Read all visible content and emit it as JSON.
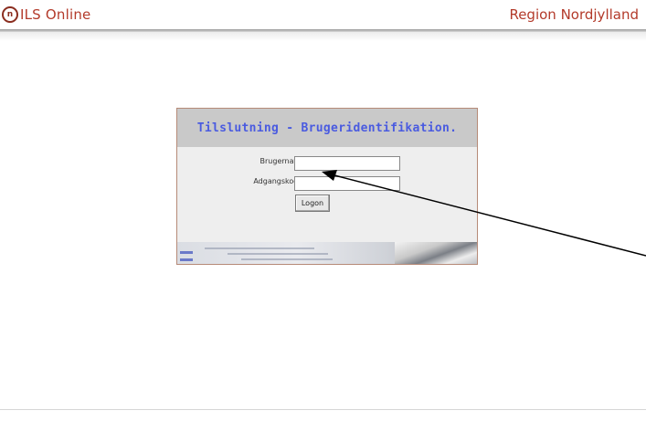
{
  "header": {
    "logo_text": "n",
    "app_title": "ILS Online",
    "region": "Region Nordjylland"
  },
  "login": {
    "title": "Tilslutning - Brugeridentifikation.",
    "username_label": "Brugernavn:",
    "username_value": "",
    "password_label": "Adgangskode:",
    "password_value": "",
    "logon_button": "Logon"
  },
  "colors": {
    "brand": "#b33a2a",
    "title_blue": "#4a5be0",
    "panel_border": "#b68a78"
  }
}
